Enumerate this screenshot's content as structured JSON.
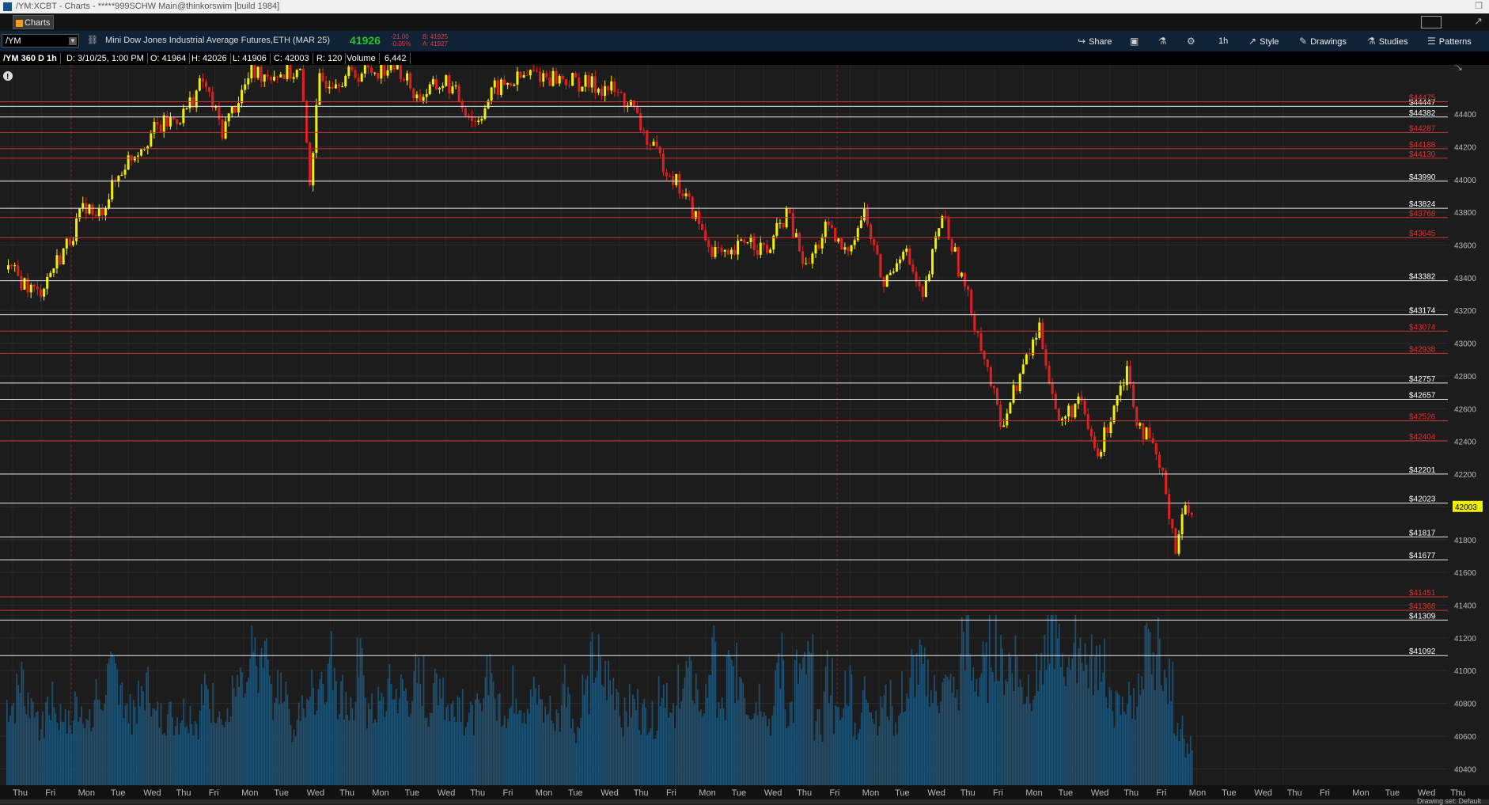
{
  "window": {
    "title": "/YM:XCBT - Charts - *****999SCHW Main@thinkorswim [build 1984]"
  },
  "tab": {
    "label": "Charts"
  },
  "toolbar": {
    "symbol": "/YM",
    "description": "Mini Dow Jones Industrial Average Futures,ETH (MAR 25)",
    "last_price": "41926",
    "change": "-21.00",
    "change_pct": "-0.05%",
    "bid": "B: 41925",
    "ask": "A: 41927",
    "share_label": "Share",
    "interval_label": "1h",
    "style_label": "Style",
    "drawings_label": "Drawings",
    "studies_label": "Studies",
    "patterns_label": "Patterns"
  },
  "infobar": {
    "period": "/YM 360 D 1h",
    "date": "D: 3/10/25, 1:00 PM",
    "open": "O: 41964",
    "high": "H: 42026",
    "low": "L: 41906",
    "close": "C: 42003",
    "range": "R: 120",
    "volume_label": "Volume",
    "volume_value": "6,442"
  },
  "status": {
    "text": "Drawing set: Default"
  },
  "colors": {
    "up_candle": "#f0f000",
    "down_candle": "#e02020",
    "volume": "#1d4f70",
    "white_level": "#e8e8e8",
    "red_level": "#d03030",
    "current_price_bg": "#f0f000"
  },
  "chart_data": {
    "type": "candlestick",
    "ylim": [
      40300,
      44700
    ],
    "y_ticks": [
      44400,
      44200,
      44000,
      43800,
      43600,
      43400,
      43200,
      43000,
      42800,
      42600,
      42400,
      42200,
      42000,
      41800,
      41600,
      41400,
      41200,
      41000,
      40800,
      40600,
      40400
    ],
    "x_labels": [
      "Thu",
      "Fri",
      "Mon",
      "Tue",
      "Wed",
      "Thu",
      "Fri",
      "Mon",
      "Tue",
      "Wed",
      "Thu",
      "Mon",
      "Tue",
      "Wed",
      "Thu",
      "Fri",
      "Mon",
      "Tue",
      "Wed",
      "Thu",
      "Fri",
      "Mon",
      "Tue",
      "Wed",
      "Thu",
      "Fri",
      "Mon",
      "Tue",
      "Wed",
      "Thu",
      "Fri",
      "Mon",
      "Tue",
      "Wed",
      "Thu",
      "Fri",
      "Mon",
      "Tue",
      "Wed",
      "Thu",
      "Fri",
      "Mon",
      "Tue",
      "Wed",
      "Thu"
    ],
    "current_price": "42003",
    "levels": [
      {
        "price": 44447,
        "label": "$44447",
        "color": "white"
      },
      {
        "price": 44475,
        "label": "$44475",
        "color": "red"
      },
      {
        "price": 44382,
        "label": "$44382",
        "color": "white"
      },
      {
        "price": 44287,
        "label": "$44287",
        "color": "red"
      },
      {
        "price": 44188,
        "label": "$44188",
        "color": "red"
      },
      {
        "price": 44130,
        "label": "$44130",
        "color": "red"
      },
      {
        "price": 43990,
        "label": "$43990",
        "color": "white"
      },
      {
        "price": 43824,
        "label": "$43824",
        "color": "white"
      },
      {
        "price": 43768,
        "label": "$43768",
        "color": "red"
      },
      {
        "price": 43645,
        "label": "$43645",
        "color": "red"
      },
      {
        "price": 43382,
        "label": "$43382",
        "color": "white"
      },
      {
        "price": 43174,
        "label": "$43174",
        "color": "white"
      },
      {
        "price": 43074,
        "label": "$43074",
        "color": "red"
      },
      {
        "price": 42938,
        "label": "$42938",
        "color": "red"
      },
      {
        "price": 42757,
        "label": "$42757",
        "color": "white"
      },
      {
        "price": 42657,
        "label": "$42657",
        "color": "white"
      },
      {
        "price": 42526,
        "label": "$42526",
        "color": "red"
      },
      {
        "price": 42404,
        "label": "$42404",
        "color": "red"
      },
      {
        "price": 42201,
        "label": "$42201",
        "color": "white"
      },
      {
        "price": 42023,
        "label": "$42023",
        "color": "white"
      },
      {
        "price": 41817,
        "label": "$41817",
        "color": "white"
      },
      {
        "price": 41677,
        "label": "$41677",
        "color": "white"
      },
      {
        "price": 41451,
        "label": "$41451",
        "color": "red"
      },
      {
        "price": 41368,
        "label": "$41368",
        "color": "red"
      },
      {
        "price": 41309,
        "label": "$41309",
        "color": "white"
      },
      {
        "price": 41092,
        "label": "$41092",
        "color": "white"
      }
    ],
    "price_path": [
      [
        0,
        43450
      ],
      [
        3,
        43300
      ],
      [
        6,
        43600
      ],
      [
        8,
        43850
      ],
      [
        9,
        43750
      ],
      [
        12,
        44100
      ],
      [
        15,
        44300
      ],
      [
        18,
        44400
      ],
      [
        20,
        44600
      ],
      [
        22,
        44300
      ],
      [
        25,
        44650
      ],
      [
        30,
        44650
      ],
      [
        31,
        44000
      ],
      [
        32,
        44600
      ],
      [
        36,
        44650
      ],
      [
        40,
        44700
      ],
      [
        42,
        44500
      ],
      [
        45,
        44600
      ],
      [
        48,
        44350
      ],
      [
        50,
        44550
      ],
      [
        54,
        44650
      ],
      [
        58,
        44600
      ],
      [
        62,
        44550
      ],
      [
        64,
        44450
      ],
      [
        66,
        44200
      ],
      [
        68,
        44050
      ],
      [
        70,
        43850
      ],
      [
        72,
        43600
      ],
      [
        74,
        43500
      ],
      [
        76,
        43650
      ],
      [
        78,
        43550
      ],
      [
        80,
        43800
      ],
      [
        82,
        43450
      ],
      [
        84,
        43700
      ],
      [
        86,
        43550
      ],
      [
        88,
        43800
      ],
      [
        90,
        43350
      ],
      [
        92,
        43600
      ],
      [
        94,
        43250
      ],
      [
        96,
        43800
      ],
      [
        97,
        43600
      ],
      [
        99,
        43200
      ],
      [
        100,
        43000
      ],
      [
        102,
        42500
      ],
      [
        104,
        42800
      ],
      [
        106,
        43100
      ],
      [
        107,
        42800
      ],
      [
        108,
        42500
      ],
      [
        110,
        42650
      ],
      [
        112,
        42300
      ],
      [
        114,
        42700
      ],
      [
        115,
        42850
      ],
      [
        116,
        42550
      ],
      [
        118,
        42300
      ],
      [
        119,
        42100
      ],
      [
        120,
        41750
      ],
      [
        121,
        42003
      ]
    ],
    "volume_profile": [
      [
        0,
        0.65
      ],
      [
        10,
        0.7
      ],
      [
        20,
        0.72
      ],
      [
        25,
        0.75
      ],
      [
        30,
        0.7
      ],
      [
        31,
        0.95
      ],
      [
        35,
        0.72
      ],
      [
        40,
        0.7
      ],
      [
        45,
        0.7
      ],
      [
        50,
        0.75
      ],
      [
        55,
        0.7
      ],
      [
        60,
        0.72
      ],
      [
        65,
        0.78
      ],
      [
        70,
        0.75
      ],
      [
        75,
        0.72
      ],
      [
        80,
        0.73
      ],
      [
        85,
        0.7
      ],
      [
        90,
        0.72
      ],
      [
        95,
        0.8
      ],
      [
        96,
        1.0
      ],
      [
        100,
        0.9
      ],
      [
        102,
        0.95
      ],
      [
        104,
        0.92
      ],
      [
        105,
        0.98
      ],
      [
        110,
        0.85
      ],
      [
        115,
        0.82
      ],
      [
        118,
        0.78
      ],
      [
        120,
        0.7
      ],
      [
        121,
        0.45
      ]
    ]
  }
}
